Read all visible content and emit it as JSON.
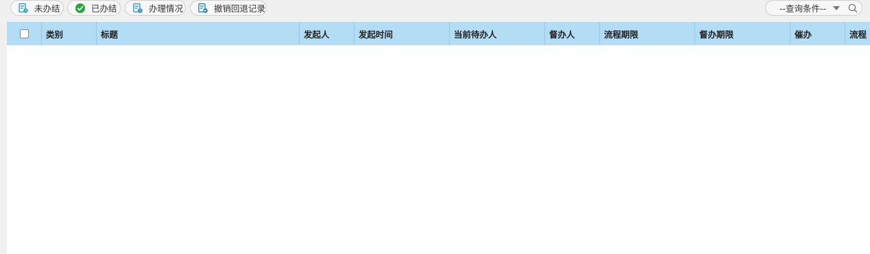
{
  "toolbar": {
    "tabs": [
      {
        "label": "未办结",
        "icon": "form-pending-icon"
      },
      {
        "label": "已办结",
        "icon": "check-circle-icon",
        "icon_color": "#22a83a"
      },
      {
        "label": "办理情况",
        "icon": "form-help-icon"
      },
      {
        "label": "撤销回退记录",
        "icon": "form-revoke-icon"
      }
    ],
    "query": {
      "label": "--查询条件--",
      "icon": "search-icon"
    }
  },
  "grid": {
    "header_color": "#b3dcf5",
    "columns": [
      "类别",
      "标题",
      "发起人",
      "发起时间",
      "当前待办人",
      "督办人",
      "流程期限",
      "督办期限",
      "催办",
      "流程"
    ],
    "rows": []
  }
}
